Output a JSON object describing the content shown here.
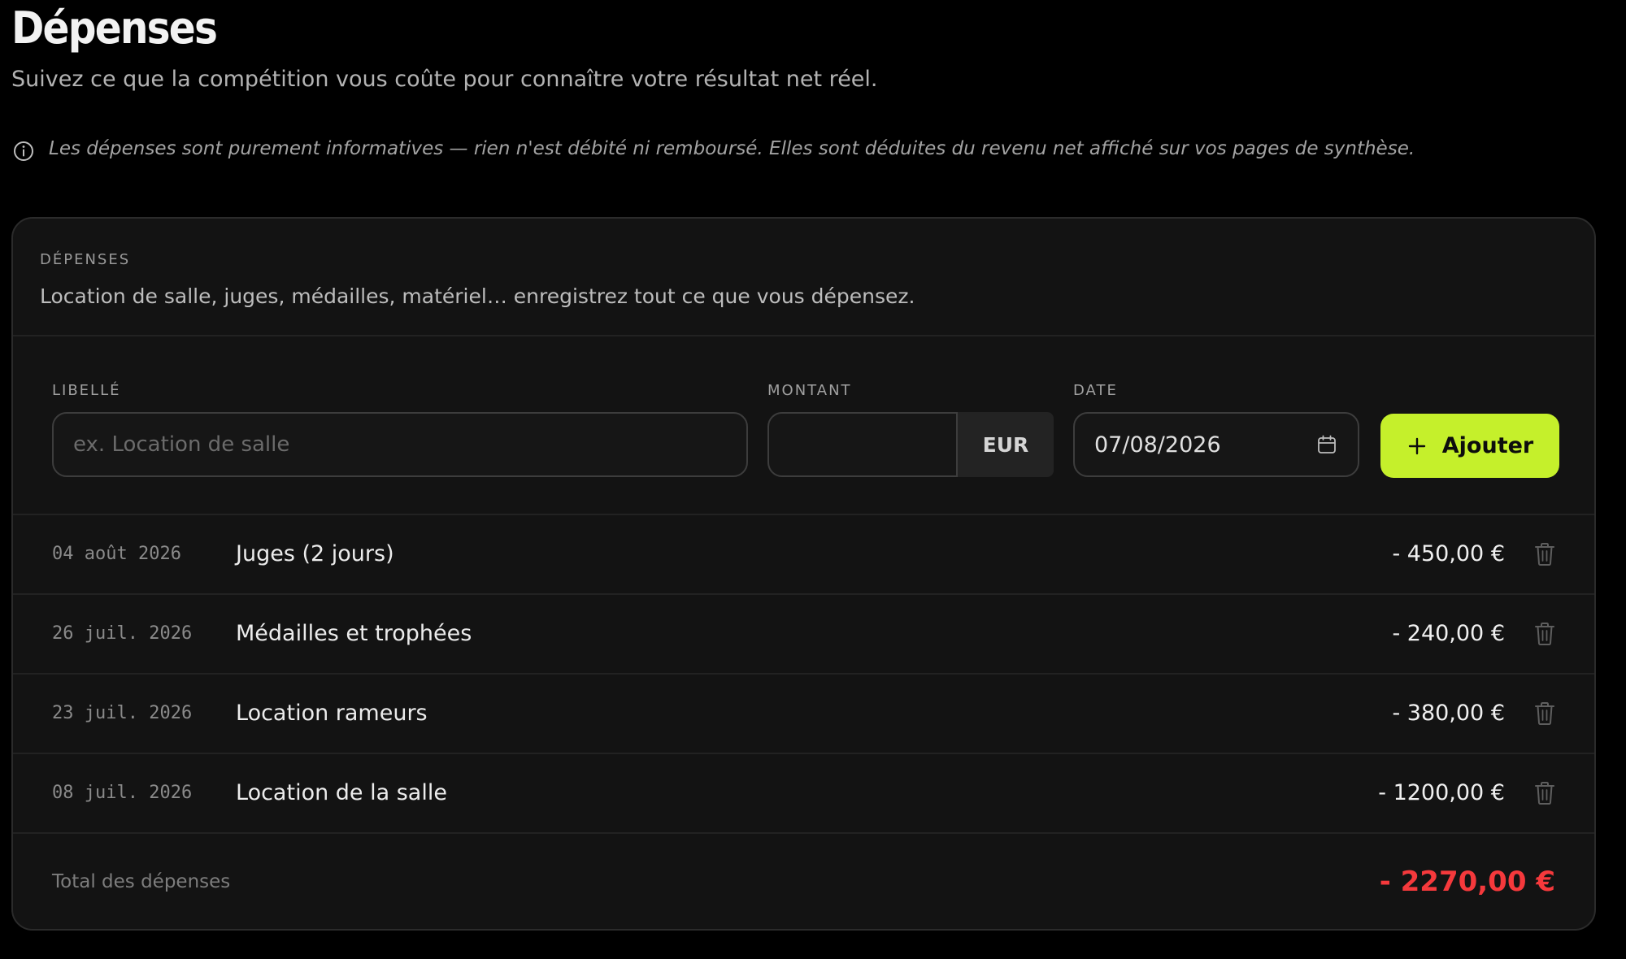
{
  "header": {
    "title": "Dépenses",
    "subtitle": "Suivez ce que la compétition vous coûte pour connaître votre résultat net réel.",
    "info_icon": "info-circle-icon",
    "info_text": "Les dépenses sont purement informatives — rien n'est débité ni remboursé. Elles sont déduites du revenu net affiché sur vos pages de synthèse."
  },
  "card": {
    "eyebrow": "DÉPENSES",
    "description": "Location de salle, juges, médailles, matériel… enregistrez tout ce que vous dépensez."
  },
  "form": {
    "libelle_label": "LIBELLÉ",
    "libelle_placeholder": "ex. Location de salle",
    "libelle_value": "",
    "montant_label": "MONTANT",
    "montant_value": "",
    "currency": "EUR",
    "date_label": "DATE",
    "date_value": "07/08/2026",
    "add_label": "Ajouter"
  },
  "expenses": [
    {
      "date": "04 août 2026",
      "label": "Juges (2 jours)",
      "amount": "- 450,00 €"
    },
    {
      "date": "26 juil. 2026",
      "label": "Médailles et trophées",
      "amount": "- 240,00 €"
    },
    {
      "date": "23 juil. 2026",
      "label": "Location rameurs",
      "amount": "- 380,00 €"
    },
    {
      "date": "08 juil. 2026",
      "label": "Location de la salle",
      "amount": "- 1200,00 €"
    }
  ],
  "total": {
    "label": "Total des dépenses",
    "value": "- 2270,00 €"
  },
  "colors": {
    "accent": "#c5f02b",
    "negative": "#f5393c",
    "background": "#000000",
    "card": "#131313"
  }
}
